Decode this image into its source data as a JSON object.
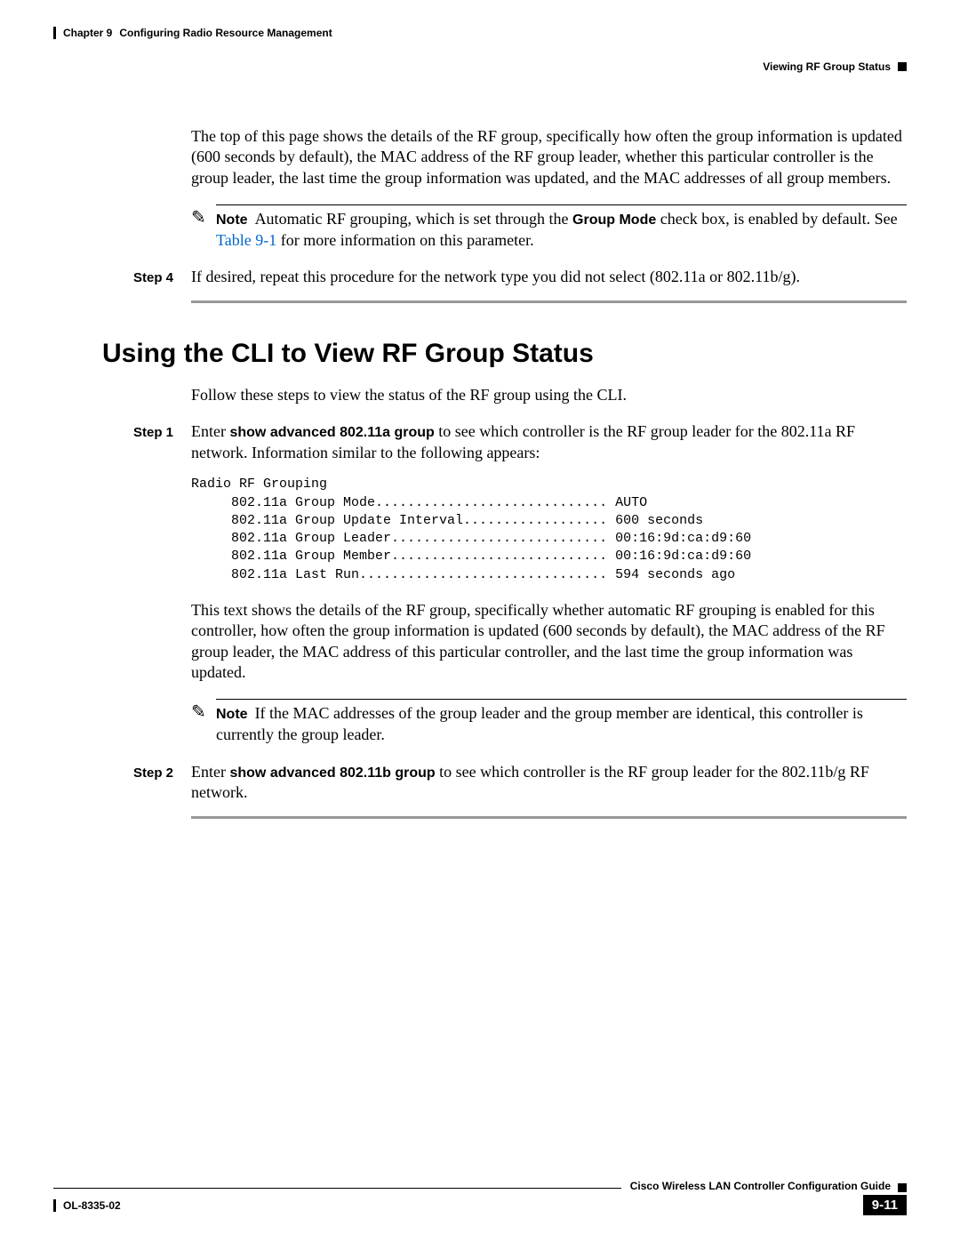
{
  "header": {
    "chapter": "Chapter 9",
    "chapter_title": "Configuring Radio Resource Management",
    "section_right": "Viewing RF Group Status"
  },
  "intro_para": "The top of this page shows the details of the RF group, specifically how often the group information is updated (600 seconds by default), the MAC address of the RF group leader, whether this particular controller is the group leader, the last time the group information was updated, and the MAC addresses of all group members.",
  "note1": {
    "label": "Note",
    "text_before": "Automatic RF grouping, which is set through the ",
    "bold": "Group Mode",
    "text_mid": " check box, is enabled by default. See ",
    "link": "Table 9-1",
    "text_after": " for more information on this parameter."
  },
  "step4": {
    "label": "Step 4",
    "text": "If desired, repeat this procedure for the network type you did not select (802.11a or 802.11b/g)."
  },
  "heading": "Using the CLI to View RF Group Status",
  "follow": "Follow these steps to view the status of the RF group using the CLI.",
  "step1": {
    "label": "Step 1",
    "pre": "Enter ",
    "bold": "show advanced 802.11a group",
    "post": " to see which controller is the RF group leader for the 802.11a RF network. Information similar to the following appears:"
  },
  "cli": "Radio RF Grouping\n     802.11a Group Mode............................. AUTO\n     802.11a Group Update Interval.................. 600 seconds\n     802.11a Group Leader........................... 00:16:9d:ca:d9:60\n     802.11a Group Member........................... 00:16:9d:ca:d9:60\n     802.11a Last Run............................... 594 seconds ago",
  "explain": "This text shows the details of the RF group, specifically whether automatic RF grouping is enabled for this controller, how often the group information is updated (600 seconds by default), the MAC address of the RF group leader, the MAC address of this particular controller, and the last time the group information was updated.",
  "note2": {
    "label": "Note",
    "text": "If the MAC addresses of the group leader and the group member are identical, this controller is currently the group leader."
  },
  "step2": {
    "label": "Step 2",
    "pre": "Enter ",
    "bold": "show advanced 802.11b group",
    "post": " to see which controller is the RF group leader for the 802.11b/g RF network."
  },
  "footer": {
    "guide": "Cisco Wireless LAN Controller Configuration Guide",
    "doc": "OL-8335-02",
    "page": "9-11"
  }
}
